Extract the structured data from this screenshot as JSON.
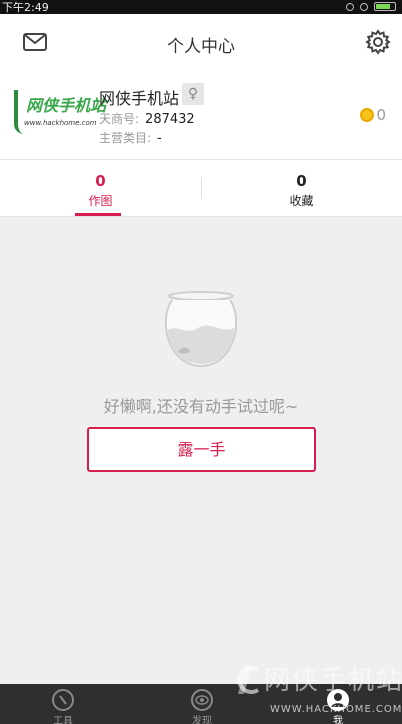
{
  "status_bar": {
    "time": "下午2:49"
  },
  "header": {
    "title": "个人中心"
  },
  "profile": {
    "logo_text": "网侠手机站",
    "logo_url": "www.hackhome.com",
    "name": "网侠手机站",
    "gender_symbol": "♀",
    "shop_id_label": "天商号:",
    "shop_id_value": "287432",
    "category_label": "主营类目:",
    "category_value": "-",
    "coins": "0"
  },
  "tabs": [
    {
      "count": "0",
      "label": "作图",
      "active": true
    },
    {
      "count": "0",
      "label": "收藏",
      "active": false
    }
  ],
  "empty_state": {
    "message": "好懒啊,还没有动手试过呢~",
    "button_label": "露一手"
  },
  "watermark": {
    "text": "网侠手机站",
    "url": "WWW.HACKHOME.COM"
  },
  "bottom_nav": [
    {
      "label": "工具",
      "icon": "brush-icon"
    },
    {
      "label": "发现",
      "icon": "eye-icon"
    },
    {
      "label": "我",
      "icon": "person-icon",
      "active": true
    }
  ],
  "colors": {
    "accent": "#d81e4f",
    "coin": "#f5c418",
    "nav_bg": "#2f2f2f"
  }
}
